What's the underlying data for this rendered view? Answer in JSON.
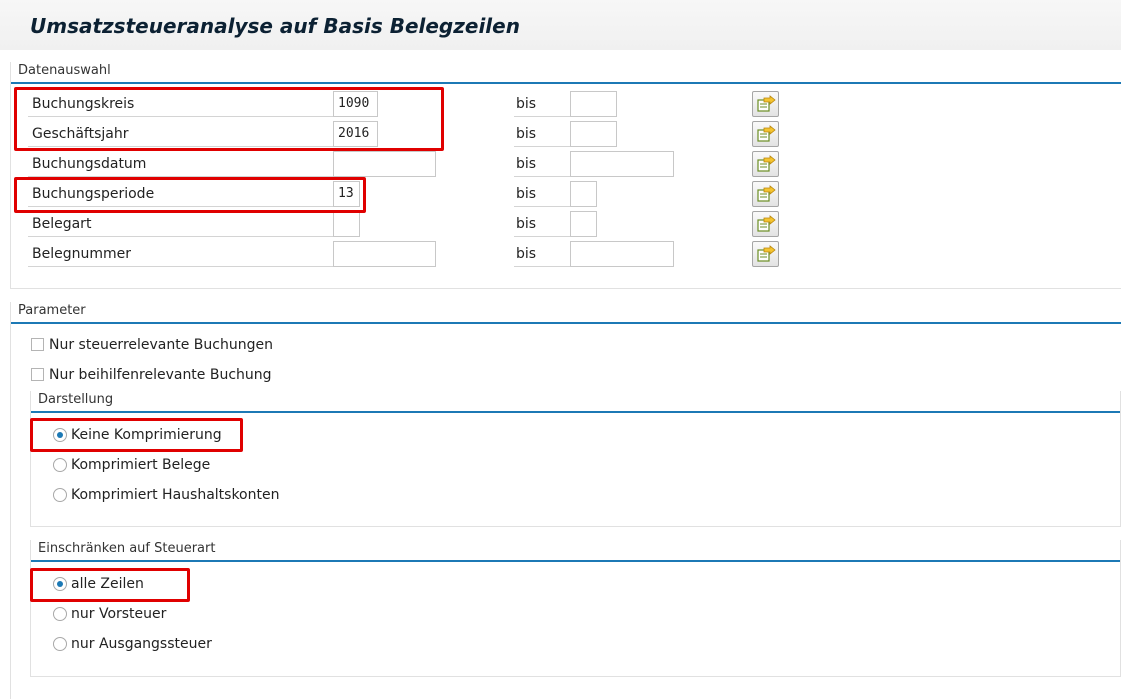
{
  "title": "Umsatzsteueranalyse auf Basis Belegzeilen",
  "colors": {
    "accent": "#1c79b5",
    "highlight": "#e00000"
  },
  "datenauswahl": {
    "header": "Datenauswahl",
    "bis_label": "bis",
    "multiple_selection_icon": "multiple-selection-icon",
    "fields": [
      {
        "label": "Buchungskreis",
        "from": "1090",
        "to": ""
      },
      {
        "label": "Geschäftsjahr",
        "from": "2016",
        "to": ""
      },
      {
        "label": "Buchungsdatum",
        "from": "",
        "to": ""
      },
      {
        "label": "Buchungsperiode",
        "from": "13",
        "to": ""
      },
      {
        "label": "Belegart",
        "from": "",
        "to": ""
      },
      {
        "label": "Belegnummer",
        "from": "",
        "to": ""
      }
    ]
  },
  "parameter": {
    "header": "Parameter",
    "checkboxes": [
      {
        "label": "Nur steuerrelevante Buchungen",
        "checked": false
      },
      {
        "label": "Nur beihilfenrelevante Buchung",
        "checked": false
      }
    ],
    "darstellung": {
      "header": "Darstellung",
      "options": [
        "Keine Komprimierung",
        "Komprimiert Belege",
        "Komprimiert Haushaltskonten"
      ],
      "selected": "Keine Komprimierung"
    },
    "steuerart": {
      "header": "Einschränken auf Steuerart",
      "options": [
        "alle Zeilen",
        "nur Vorsteuer",
        "nur Ausgangssteuer"
      ],
      "selected": "alle Zeilen"
    }
  }
}
